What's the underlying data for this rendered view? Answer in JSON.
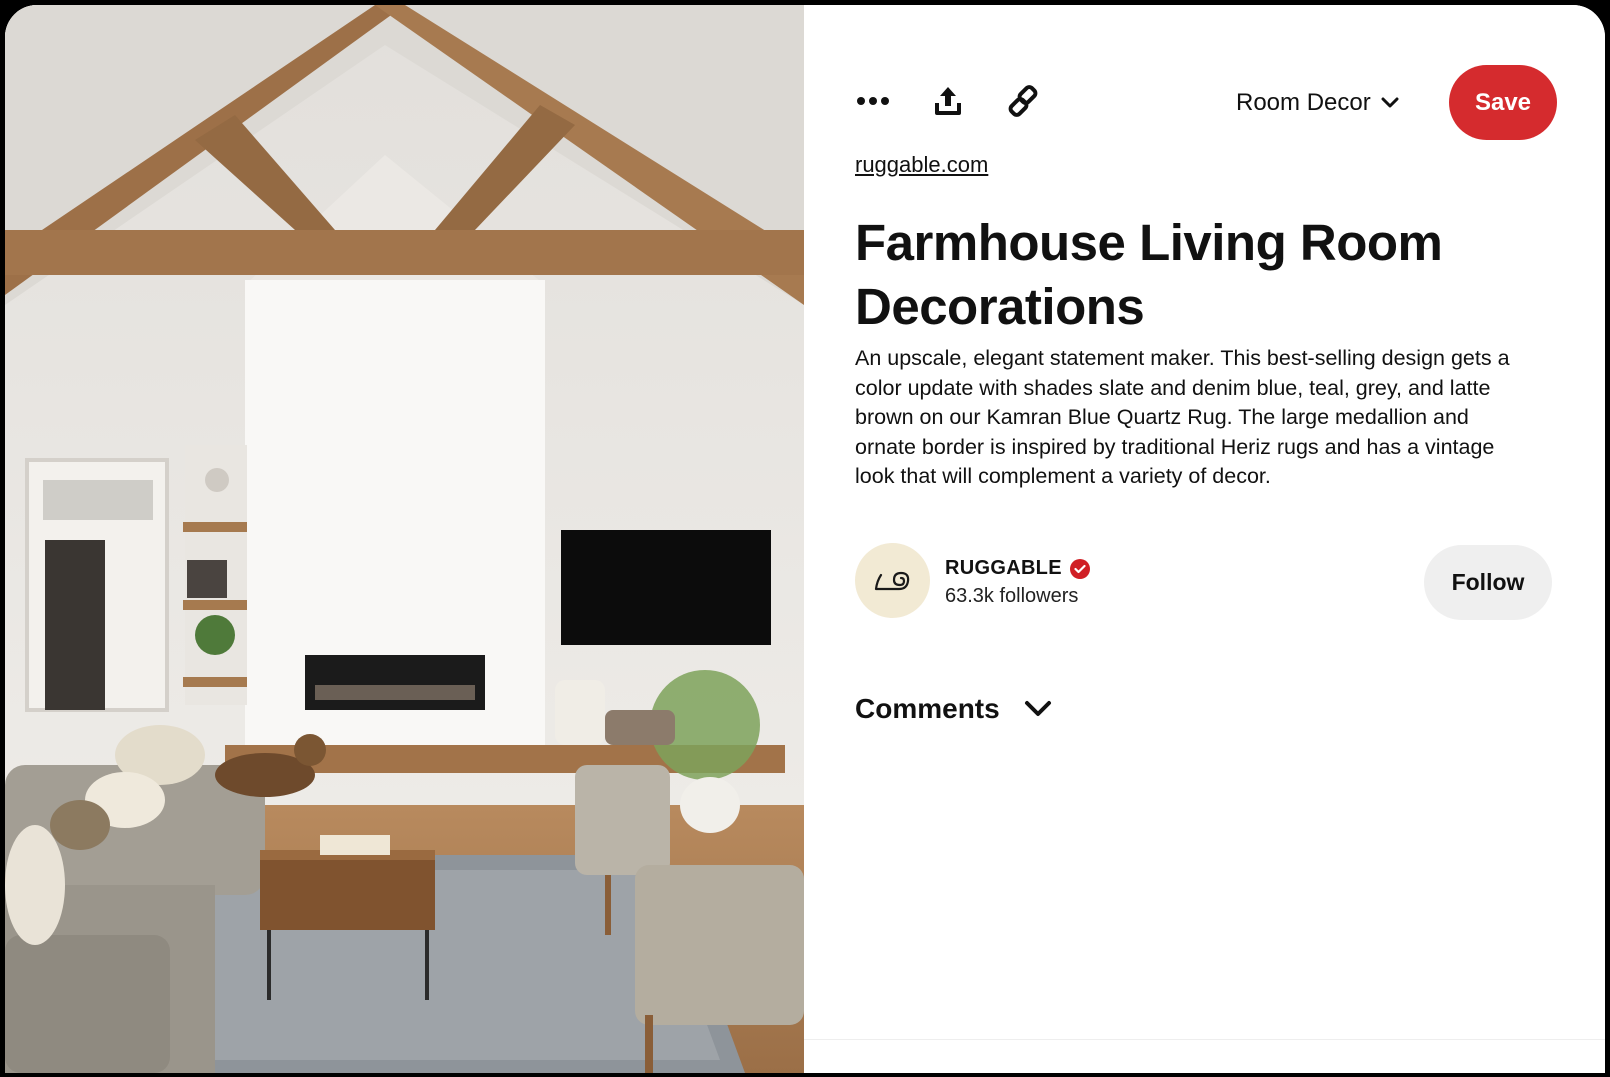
{
  "toolbar": {
    "more_icon": "more-dots-icon",
    "share_icon": "share-upload-icon",
    "link_icon": "link-chain-icon",
    "board_name": "Room Decor",
    "board_icon": "chevron-down-icon",
    "save_label": "Save"
  },
  "pin": {
    "source": "ruggable.com",
    "title": "Farmhouse Living Room Decorations",
    "description": "An upscale, elegant statement maker. This best-selling design gets a color update with shades slate and denim blue, teal, grey, and latte brown on our Kamran Blue Quartz Rug. The large medallion and ornate border is inspired by traditional Heriz rugs and has a vintage look that will complement a variety of decor.",
    "image_alt": "Farmhouse living room with vaulted wood-beam ceiling, white brick fireplace, TV, sectional sofa, coffee table, dog and rug"
  },
  "creator": {
    "name": "RUGGABLE",
    "verified": true,
    "followers": "63.3k followers",
    "follow_label": "Follow"
  },
  "comments": {
    "label": "Comments"
  },
  "colors": {
    "save_red": "#d52b2e",
    "verified_red": "#d01f25",
    "follow_bg": "#efefef",
    "avatar_bg": "#f2ead4"
  }
}
